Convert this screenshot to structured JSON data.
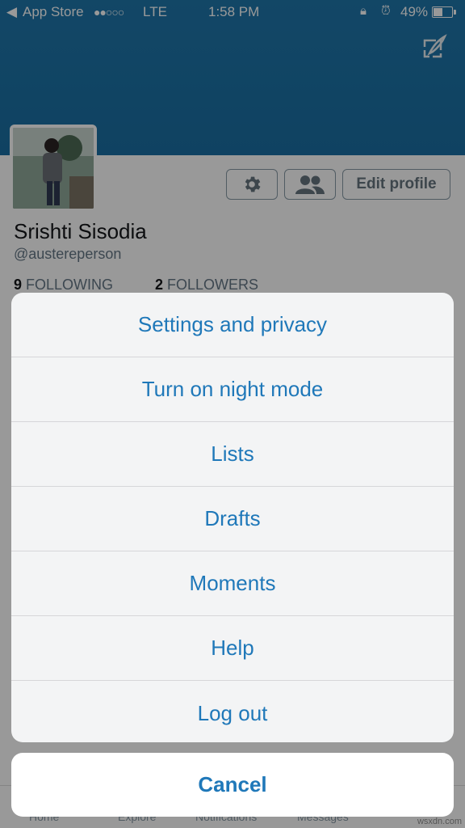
{
  "status_bar": {
    "back_glyph": "◀",
    "carrier": "App Store",
    "signal": "●●○○○",
    "network": "LTE",
    "time": "1:58 PM",
    "lock_icon": "orientation-lock-icon",
    "alarm_icon": "alarm-icon",
    "battery_percent": "49%"
  },
  "header": {
    "compose_icon": "compose-tweet-icon",
    "band_color": "#1f77ab"
  },
  "profile": {
    "display_name": "Srishti Sisodia",
    "handle": "@austereperson",
    "following_count": "9",
    "following_label": "FOLLOWING",
    "followers_count": "2",
    "followers_label": "FOLLOWERS",
    "buttons": {
      "settings_icon": "gear-icon",
      "people_icon": "people-icon",
      "edit_label": "Edit profile"
    }
  },
  "tabbar": {
    "items": [
      "Home",
      "Explore",
      "Notifications",
      "Messages"
    ]
  },
  "action_sheet": {
    "items": [
      "Settings and privacy",
      "Turn on night mode",
      "Lists",
      "Drafts",
      "Moments",
      "Help",
      "Log out"
    ],
    "cancel_label": "Cancel",
    "accent_color": "#1f78b9"
  },
  "watermark": "wsxdn.com"
}
